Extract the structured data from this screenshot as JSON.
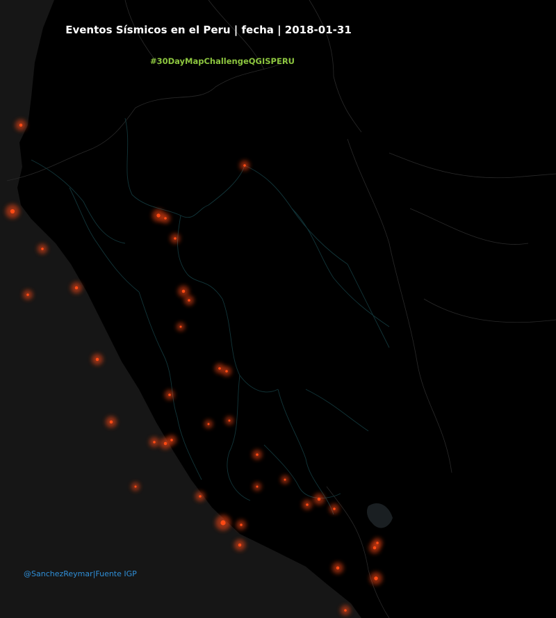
{
  "title": "Eventos Sísmicos en el Peru | fecha | 2018-01-31",
  "subtitle": "#30DayMapChallengeQGISPERU",
  "credit": "@SanchezReymar|Fuente IGP",
  "colors": {
    "ocean": "#161616",
    "land": "#000000",
    "region_border": "#12363a",
    "country_border": "#2a2a2a",
    "event": "#ff4a14",
    "subtitle": "#8dc63f",
    "credit": "#2f8fd8"
  },
  "legend": [],
  "map_data": {
    "event_count": 38
  }
}
